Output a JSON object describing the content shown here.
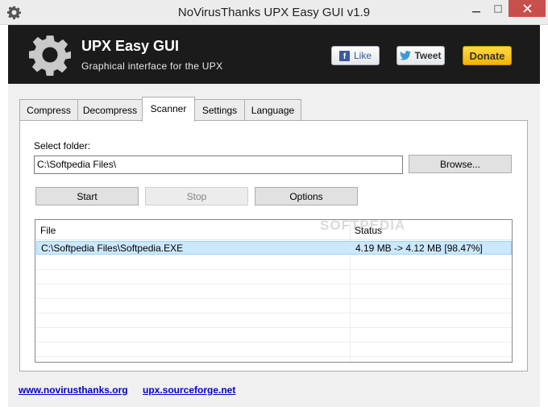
{
  "window": {
    "title": "NoVirusThanks UPX Easy GUI v1.9",
    "close_color": "#c7504c"
  },
  "header": {
    "brand": "UPX Easy GUI",
    "tagline": "Graphical interface for the UPX",
    "like_label": "Like",
    "tweet_label": "Tweet",
    "donate_label": "Donate"
  },
  "tabs": [
    {
      "label": "Compress"
    },
    {
      "label": "Decompress"
    },
    {
      "label": "Scanner"
    },
    {
      "label": "Settings"
    },
    {
      "label": "Language"
    }
  ],
  "active_tab": "Scanner",
  "scanner": {
    "folder_label": "Select folder:",
    "folder_value": "C:\\Softpedia Files\\",
    "browse_label": "Browse...",
    "start_label": "Start",
    "stop_label": "Stop",
    "options_label": "Options",
    "columns": [
      "File",
      "Status"
    ],
    "rows": [
      {
        "file": "C:\\Softpedia Files\\Softpedia.EXE",
        "status": "4.19 MB -> 4.12 MB [98.47%]"
      }
    ]
  },
  "watermark": "SOFTPEDIA",
  "footer": {
    "link1": "www.novirusthanks.org",
    "link2": "upx.sourceforge.net"
  }
}
